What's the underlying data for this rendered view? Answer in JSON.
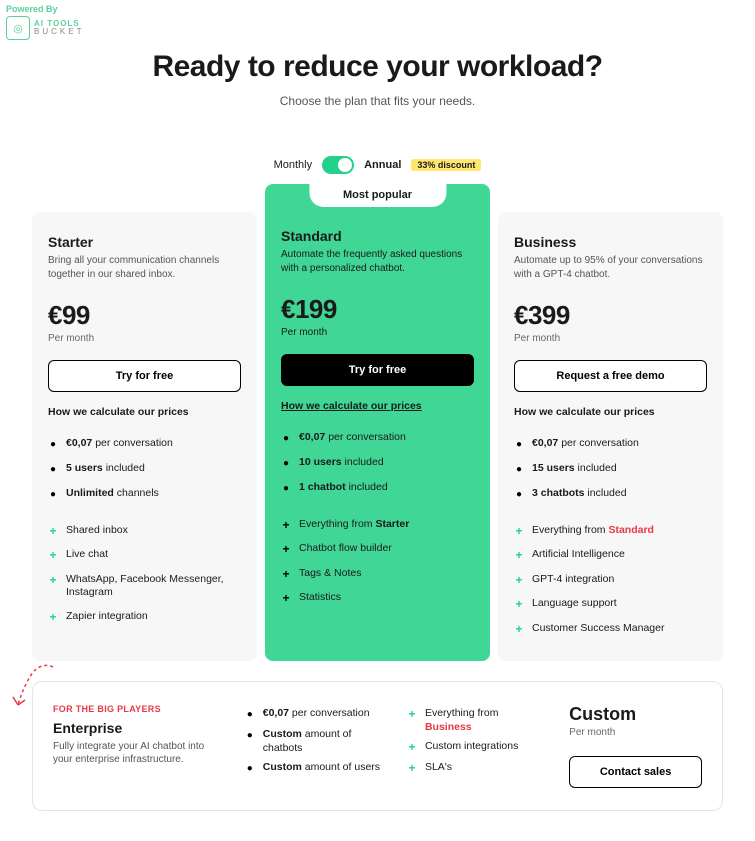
{
  "header": {
    "powered_by": "Powered By",
    "logo_line1": "AI TOOLS",
    "logo_line2": "BUCKET"
  },
  "hero": {
    "title": "Ready to reduce your workload?",
    "subtitle": "Choose the plan that fits your needs."
  },
  "billing": {
    "monthly": "Monthly",
    "annual": "Annual",
    "discount": "33% discount"
  },
  "popular_label": "Most popular",
  "calc_label": "How we calculate our prices",
  "plans": {
    "starter": {
      "name": "Starter",
      "desc": "Bring all your communication channels together in our shared inbox.",
      "price": "€99",
      "period": "Per month",
      "cta": "Try for free",
      "stats": [
        {
          "pre": "",
          "bold": "€0,07",
          "post": " per conversation"
        },
        {
          "pre": "",
          "bold": "5 users",
          "post": " included"
        },
        {
          "pre": "",
          "bold": "Unlimited",
          "post": " channels"
        }
      ],
      "features": [
        "Shared inbox",
        "Live chat",
        "WhatsApp, Facebook Messenger, Instagram",
        "Zapier integration"
      ]
    },
    "standard": {
      "name": "Standard",
      "desc": "Automate the frequently asked questions with a personalized chatbot.",
      "price": "€199",
      "period": "Per month",
      "cta": "Try for free",
      "stats": [
        {
          "pre": "",
          "bold": "€0,07",
          "post": " per conversation"
        },
        {
          "pre": "",
          "bold": "10 users",
          "post": " included"
        },
        {
          "pre": "",
          "bold": "1 chatbot",
          "post": " included"
        }
      ],
      "features_prefix": "Everything from ",
      "features_from": "Starter",
      "features": [
        "Chatbot flow builder",
        "Tags & Notes",
        "Statistics"
      ]
    },
    "business": {
      "name": "Business",
      "desc": "Automate up to 95% of your conversations with a GPT-4 chatbot.",
      "price": "€399",
      "period": "Per month",
      "cta": "Request a free demo",
      "stats": [
        {
          "pre": "",
          "bold": "€0,07",
          "post": " per conversation"
        },
        {
          "pre": "",
          "bold": "15 users",
          "post": " included"
        },
        {
          "pre": "",
          "bold": "3 chatbots",
          "post": " included"
        }
      ],
      "features_prefix": "Everything from ",
      "features_from": "Standard",
      "features": [
        "Artificial Intelligence",
        "GPT-4 integration",
        "Language support",
        "Customer Success Manager"
      ]
    }
  },
  "enterprise": {
    "label": "FOR THE BIG PLAYERS",
    "name": "Enterprise",
    "desc": "Fully integrate your AI chatbot into your enterprise infrastructure.",
    "stats": [
      {
        "bold": "€0,07",
        "post": " per conversation"
      },
      {
        "bold": "Custom",
        "post": " amount of chatbots"
      },
      {
        "bold": "Custom",
        "post": " amount of users"
      }
    ],
    "features_prefix": "Everything from ",
    "features_from": "Business",
    "features": [
      "Custom integrations",
      "SLA's"
    ],
    "title": "Custom",
    "period": "Per month",
    "cta": "Contact sales"
  }
}
